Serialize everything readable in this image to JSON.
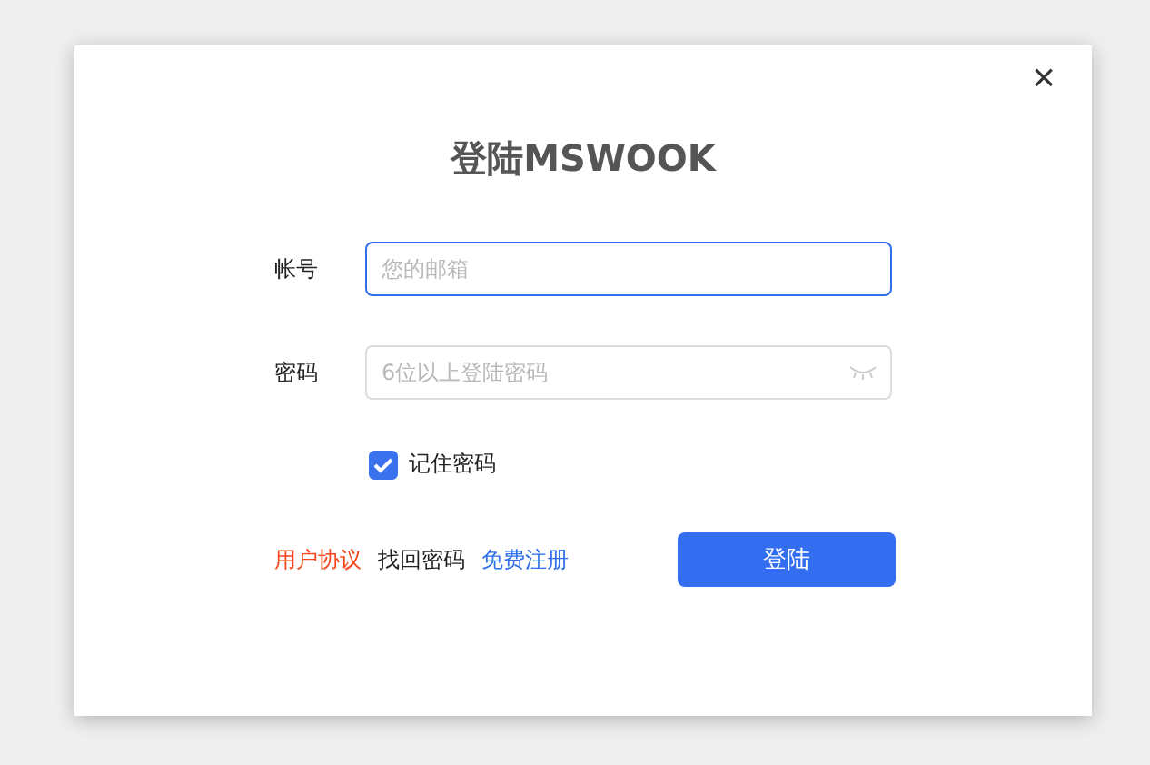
{
  "dialog": {
    "close": "×",
    "title": "登陆MSWOOK"
  },
  "fields": [
    {
      "label": "帐号",
      "placeholder": "您的邮箱",
      "focused": true,
      "kind": "text"
    },
    {
      "label": "密码",
      "placeholder": "6位以上登陆密码",
      "focused": false,
      "kind": "password"
    }
  ],
  "remember": {
    "label": "记住密码",
    "checked": true
  },
  "links": [
    {
      "text": "用户协议",
      "color": "#f5461e"
    },
    {
      "text": "找回密码",
      "color": "#222222"
    },
    {
      "text": "免费注册",
      "color": "#2f6fec"
    }
  ],
  "submit": "登陆"
}
